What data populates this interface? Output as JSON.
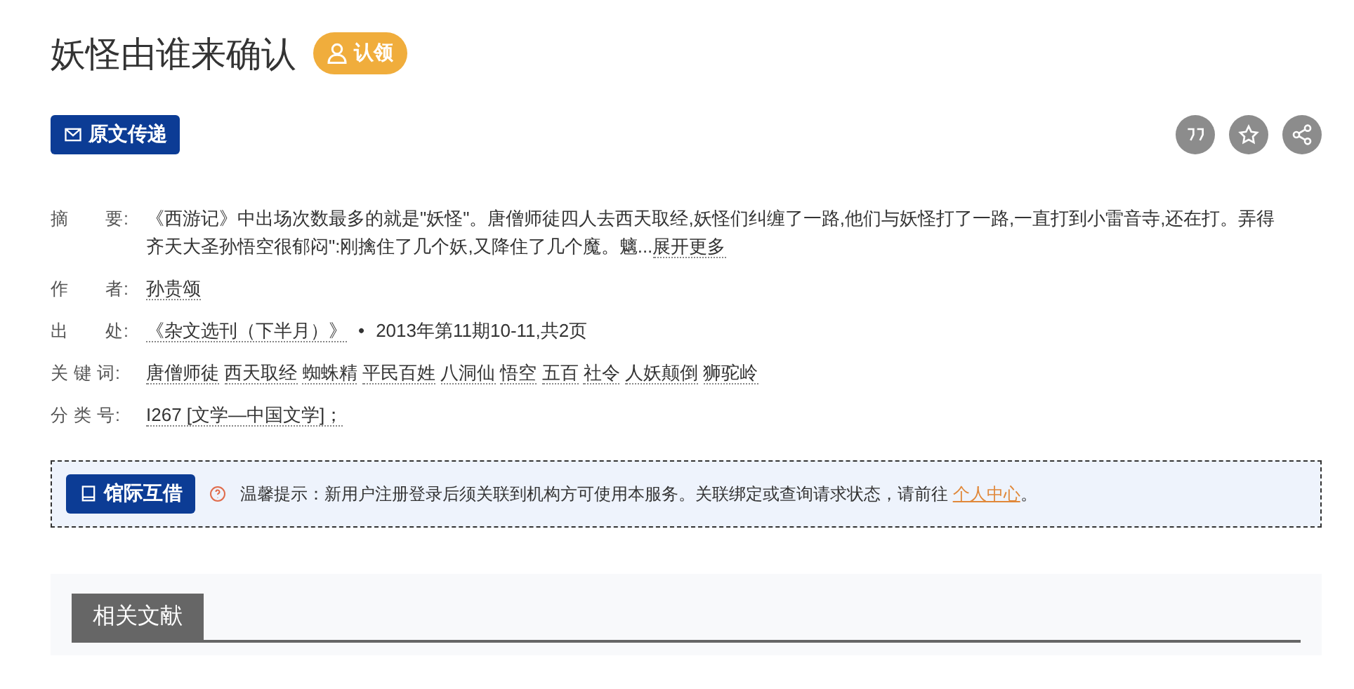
{
  "title": "妖怪由谁来确认",
  "claim_button": "认领",
  "fulltext_button": "原文传递",
  "fields": [
    {
      "kind": "abstract",
      "label": "摘　　要:",
      "text": "《西游记》中出场次数最多的就是\"妖怪\"。唐僧师徒四人去西天取经,妖怪们纠缠了一路,他们与妖怪打了一路,一直打到小雷音寺,还在打。弄得齐天大圣孙悟空很郁闷\":刚擒住了几个妖,又降住了几个魔。魑...",
      "more": "展开更多"
    },
    {
      "kind": "links",
      "label": "作　　者:",
      "links": [
        "孙贵颂"
      ]
    },
    {
      "kind": "source",
      "label": "出　　处:",
      "link": "《杂文选刊（下半月）》",
      "separator": "•",
      "detail": "2013年第11期10-11,共2页"
    },
    {
      "kind": "links",
      "label": "关 键 词:",
      "links": [
        "唐僧师徒",
        "西天取经",
        "蜘蛛精",
        "平民百姓",
        "八洞仙",
        "悟空",
        "五百",
        "社令",
        "人妖颠倒",
        "狮驼岭"
      ]
    },
    {
      "kind": "links",
      "label": "分 类 号:",
      "links": [
        "I267 [文学—中国文学]；"
      ]
    }
  ],
  "notice": {
    "button": "馆际互借",
    "text": "温馨提示：新用户注册登录后须关联到机构方可使用本服务。关联绑定或查询请求状态，请前往",
    "link": "个人中心",
    "end": "。"
  },
  "related": {
    "tab": "相关文献"
  }
}
